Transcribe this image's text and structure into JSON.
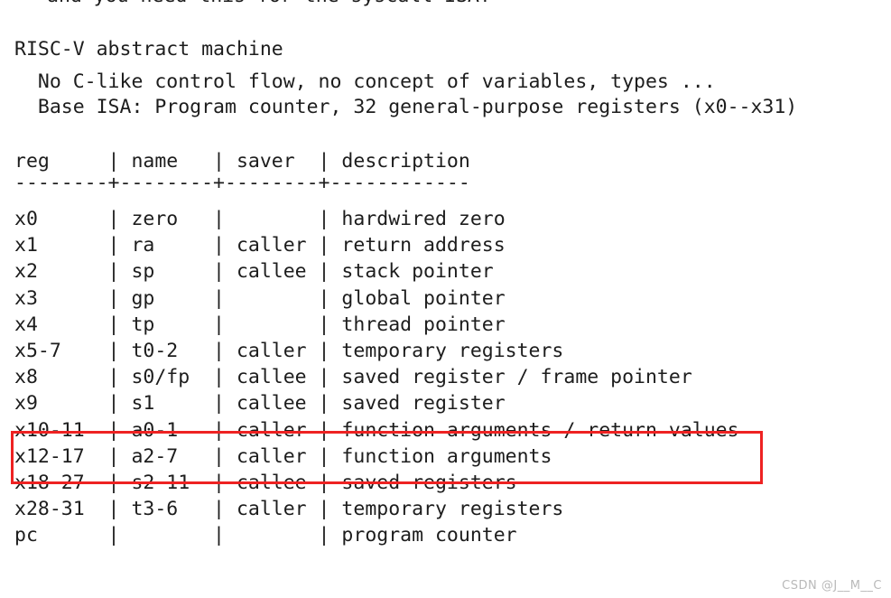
{
  "slide": {
    "clipped_top_line": "and you need this for the syscall ISA!",
    "heading": {
      "title": "RISC-V abstract machine",
      "bullet_1": "  No C-like control flow, no concept of variables, types ...",
      "bullet_2": "  Base ISA: Program counter, 32 general-purpose registers (x0--x31)"
    },
    "table": {
      "header_line": "reg     | name   | saver  | description",
      "separator_line": "--------+--------+--------+------------",
      "columns": [
        "reg",
        "name",
        "saver",
        "description"
      ],
      "rows": [
        {
          "reg": "x0",
          "name": "zero",
          "saver": "",
          "description": "hardwired zero",
          "line": "x0      | zero   |        | hardwired zero"
        },
        {
          "reg": "x1",
          "name": "ra",
          "saver": "caller",
          "description": "return address",
          "line": "x1      | ra     | caller | return address"
        },
        {
          "reg": "x2",
          "name": "sp",
          "saver": "callee",
          "description": "stack pointer",
          "line": "x2      | sp     | callee | stack pointer"
        },
        {
          "reg": "x3",
          "name": "gp",
          "saver": "",
          "description": "global pointer",
          "line": "x3      | gp     |        | global pointer"
        },
        {
          "reg": "x4",
          "name": "tp",
          "saver": "",
          "description": "thread pointer",
          "line": "x4      | tp     |        | thread pointer"
        },
        {
          "reg": "x5-7",
          "name": "t0-2",
          "saver": "caller",
          "description": "temporary registers",
          "line": "x5-7    | t0-2   | caller | temporary registers"
        },
        {
          "reg": "x8",
          "name": "s0/fp",
          "saver": "callee",
          "description": "saved register / frame pointer",
          "line": "x8      | s0/fp  | callee | saved register / frame pointer"
        },
        {
          "reg": "x9",
          "name": "s1",
          "saver": "callee",
          "description": "saved register",
          "line": "x9      | s1     | callee | saved register"
        },
        {
          "reg": "x10-11",
          "name": "a0-1",
          "saver": "caller",
          "description": "function arguments / return values",
          "line": "x10-11  | a0-1   | caller | function arguments / return values"
        },
        {
          "reg": "x12-17",
          "name": "a2-7",
          "saver": "caller",
          "description": "function arguments",
          "line": "x12-17  | a2-7   | caller | function arguments"
        },
        {
          "reg": "x18-27",
          "name": "s2-11",
          "saver": "callee",
          "description": "saved registers",
          "line": "x18-27  | s2-11  | callee | saved registers"
        },
        {
          "reg": "x28-31",
          "name": "t3-6",
          "saver": "caller",
          "description": "temporary registers",
          "line": "x28-31  | t3-6   | caller | temporary registers"
        },
        {
          "reg": "pc",
          "name": "",
          "saver": "",
          "description": "program counter",
          "line": "pc      |        |        | program counter"
        }
      ]
    },
    "highlight": {
      "label": "argument-registers-highlight",
      "color": "#ee2222",
      "covers_rows": [
        "x10-11",
        "x12-17"
      ]
    },
    "watermark": "CSDN @J__M__C"
  }
}
